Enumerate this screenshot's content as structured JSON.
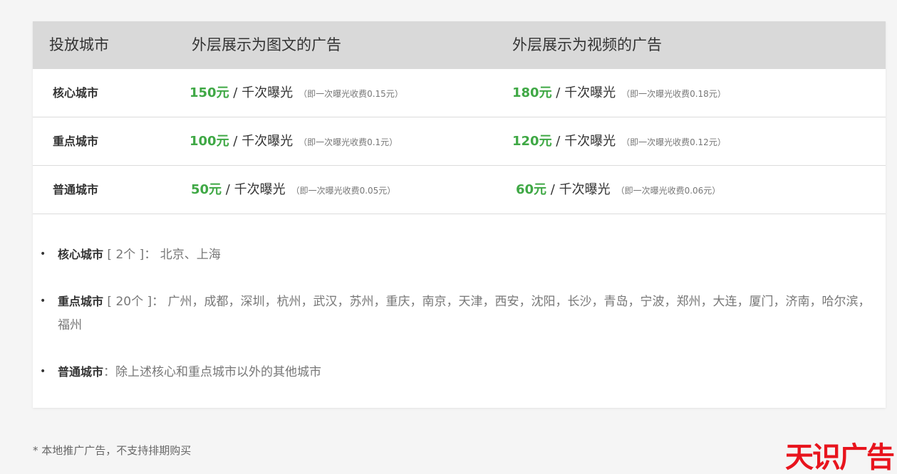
{
  "table": {
    "headers": [
      "投放城市",
      "外层展示为图文的广告",
      "外层展示为视频的广告"
    ],
    "rows": [
      {
        "city": "核心城市",
        "image_text": {
          "price": "150元",
          "unit": " / 千次曝光",
          "note": "（即一次曝光收费0.15元）"
        },
        "video": {
          "price": "180元",
          "unit": " / 千次曝光",
          "note": "（即一次曝光收费0.18元）"
        }
      },
      {
        "city": "重点城市",
        "image_text": {
          "price": "100元",
          "unit": " / 千次曝光",
          "note": "（即一次曝光收费0.1元）"
        },
        "video": {
          "price": "120元",
          "unit": " / 千次曝光",
          "note": "（即一次曝光收费0.12元）"
        }
      },
      {
        "city": "普通城市",
        "image_text": {
          "price": "50元",
          "unit": " / 千次曝光",
          "note": "（即一次曝光收费0.05元）"
        },
        "video": {
          "price": "60元",
          "unit": " / 千次曝光",
          "note": "（即一次曝光收费0.06元）"
        }
      }
    ]
  },
  "notes": [
    {
      "label": "核心城市",
      "count": " [ 2个 ]",
      "text": "： 北京、上海"
    },
    {
      "label": "重点城市",
      "count": " [ 20个 ]",
      "text": "： 广州，成都，深圳，杭州，武汉，苏州，重庆，南京，天津，西安，沈阳，长沙，青岛，宁波，郑州，大连，厦门，济南，哈尔滨，福州"
    },
    {
      "label": "普通城市",
      "count": "",
      "text": "：除上述核心和重点城市以外的其他城市"
    }
  ],
  "footnote": "* 本地推广广告，不支持排期购买",
  "logo": "天识广告",
  "colors": {
    "price": "#3fa845",
    "logo": "#e8141d",
    "header_bg": "#d9d9d9"
  }
}
